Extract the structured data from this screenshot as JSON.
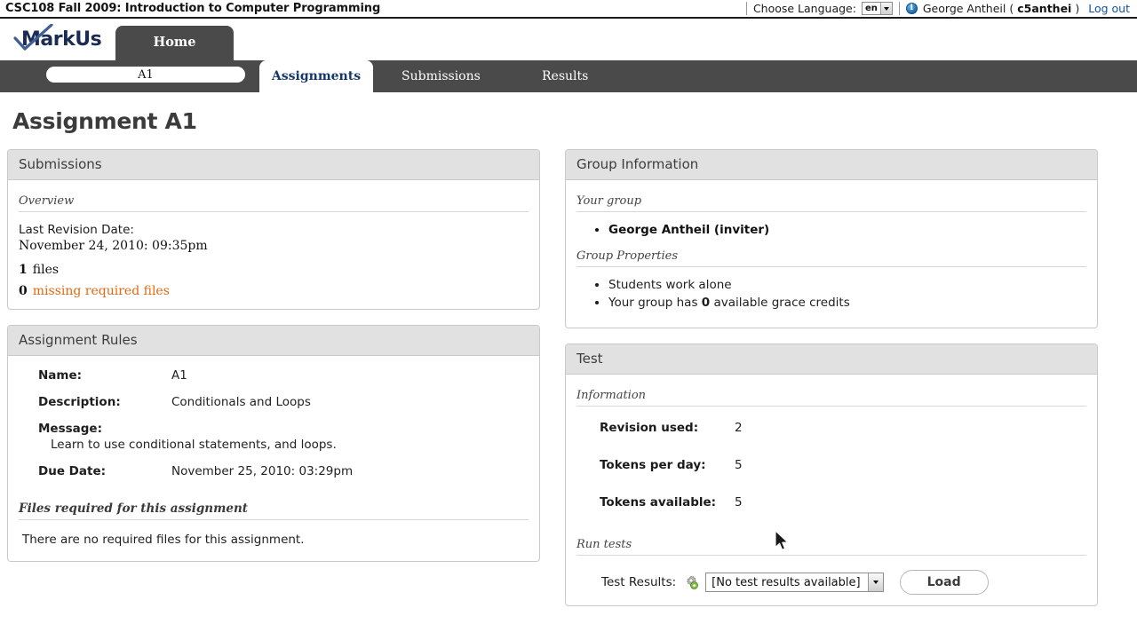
{
  "topbar": {
    "course_title": "CSC108 Fall 2009: Introduction to Computer Programming",
    "language_label": "Choose Language:",
    "language_value": "en",
    "info_icon_glyph": "i",
    "user_name": "George Antheil",
    "paren_open": "(",
    "user_id": "c5anthei",
    "paren_close": ")",
    "logout_label": "Log out"
  },
  "brand": {
    "logo_text": "MarkUs",
    "home_tab_label": "Home"
  },
  "nav": {
    "breadcrumb_pill": "A1",
    "tabs": [
      {
        "label": "Assignments",
        "active": true
      },
      {
        "label": "Submissions",
        "active": false
      },
      {
        "label": "Results",
        "active": false
      }
    ]
  },
  "page": {
    "title": "Assignment A1"
  },
  "submissions_panel": {
    "header": "Submissions",
    "section_label": "Overview",
    "last_revision_label": "Last Revision Date:",
    "last_revision_value": "November 24, 2010: 09:35pm",
    "files_count": "1",
    "files_label": "files",
    "missing_count": "0",
    "missing_link": "missing required files",
    "missing_link_color": "#e2690f"
  },
  "assignment_rules_panel": {
    "header": "Assignment Rules",
    "rows": [
      {
        "key": "Name:",
        "value": "A1"
      },
      {
        "key": "Description:",
        "value": "Conditionals and Loops"
      }
    ],
    "message_key": "Message:",
    "message_value": "Learn to use conditional statements, and loops.",
    "due_date_key": "Due Date:",
    "due_date_value": "November 25, 2010: 03:29pm",
    "files_section_label": "Files required for this assignment",
    "files_empty_text": "There are no required files for this assignment."
  },
  "group_panel": {
    "header": "Group Information",
    "your_group_label": "Your group",
    "members": [
      "George Antheil (inviter)"
    ],
    "group_properties_label": "Group Properties",
    "properties": [
      {
        "text": "Students work alone"
      },
      {
        "prefix": "Your group has ",
        "bold": "0",
        "suffix": " available grace credits"
      }
    ]
  },
  "test_panel": {
    "header": "Test",
    "information_label": "Information",
    "rows": [
      {
        "key": "Revision used:",
        "value": "2"
      },
      {
        "key": "Tokens per day:",
        "value": "5"
      },
      {
        "key": "Tokens available:",
        "value": "5"
      }
    ],
    "run_tests_label": "Run tests",
    "test_results_label": "Test Results:",
    "test_results_select_value": "[No test results available]",
    "load_button_label": "Load"
  }
}
